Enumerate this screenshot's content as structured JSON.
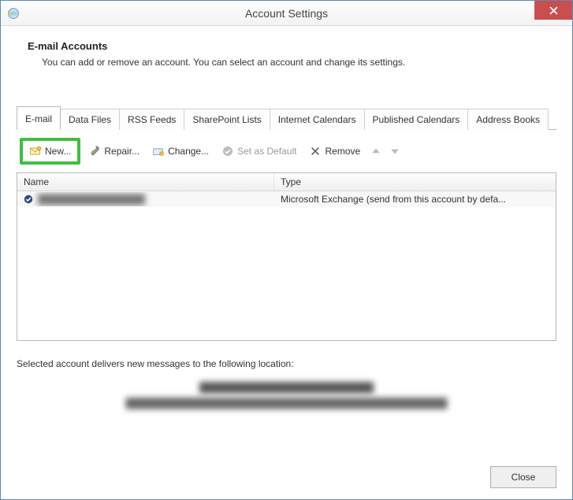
{
  "window": {
    "title": "Account Settings"
  },
  "header": {
    "title": "E-mail Accounts",
    "description": "You can add or remove an account. You can select an account and change its settings."
  },
  "tabs": [
    {
      "label": "E-mail",
      "active": true
    },
    {
      "label": "Data Files"
    },
    {
      "label": "RSS Feeds"
    },
    {
      "label": "SharePoint Lists"
    },
    {
      "label": "Internet Calendars"
    },
    {
      "label": "Published Calendars"
    },
    {
      "label": "Address Books"
    }
  ],
  "toolbar": {
    "new": "New...",
    "repair": "Repair...",
    "change": "Change...",
    "set_default": "Set as Default",
    "remove": "Remove"
  },
  "columns": {
    "name": "Name",
    "type": "Type"
  },
  "accounts": [
    {
      "name": "████████████████",
      "type": "Microsoft Exchange (send from this account by defa..."
    }
  ],
  "footer": {
    "label": "Selected account delivers new messages to the following location:",
    "line1": "██████████████████████████",
    "line2": "████████████████████████████████████████████████"
  },
  "buttons": {
    "close": "Close"
  }
}
